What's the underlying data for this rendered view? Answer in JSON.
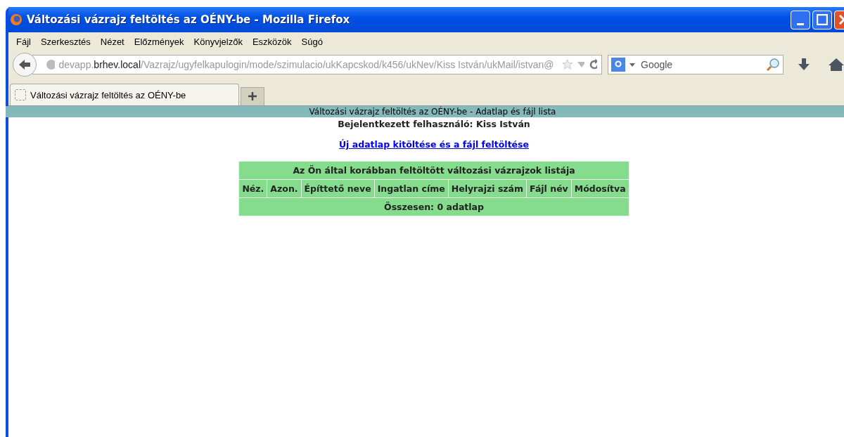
{
  "window": {
    "title": "Változási vázrajz feltöltés az OÉNY-be - Mozilla Firefox"
  },
  "menu": [
    "Fájl",
    "Szerkesztés",
    "Nézet",
    "Előzmények",
    "Könyvjelzők",
    "Eszközök",
    "Súgó"
  ],
  "address_bar": {
    "url": "devapp.**brhev.local**/Vazrajz/ugyfelkapulogin/mode/szimulacio/ukKapcskod/k456/ukNev/Kiss István/ukMail/istvan@"
  },
  "search": {
    "placeholder": "Google"
  },
  "tabs": [
    {
      "label": "Változási vázrajz feltöltés az OÉNY-be",
      "selected": true
    }
  ],
  "page": {
    "header": "Változási vázrajz feltöltés az OÉNY-be - Adatlap és fájl lista",
    "user": "Bejelentkezett felhasználó: Kiss István",
    "link": "Új adatlap kitöltése és a fájl feltöltése",
    "table": {
      "title": "Az Ön által korábban feltöltött változási vázrajzok listája",
      "columns": [
        "Néz.",
        "Azon.",
        "Építtető neve",
        "Ingatlan címe",
        "Helyrajzi szám",
        "Fájl név",
        "Módosítva"
      ],
      "footer": "Összesen: 0 adatlap"
    }
  }
}
